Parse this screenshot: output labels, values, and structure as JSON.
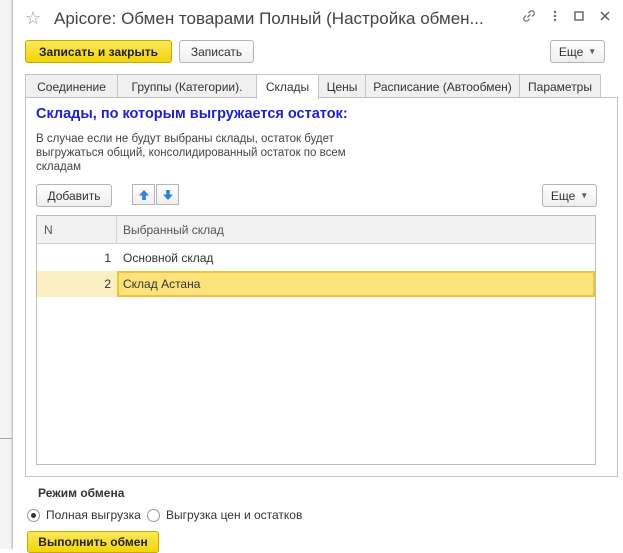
{
  "window": {
    "title": "Apicore: Обмен товарами Полный (Настройка обмен...",
    "icons": [
      "star-icon",
      "link-icon",
      "more-vertical-icon",
      "maximize-icon",
      "close-icon"
    ]
  },
  "toolbar": {
    "save_close_label": "Записать и закрыть",
    "save_label": "Записать",
    "more_label": "Еще"
  },
  "tabs": [
    {
      "label": "Соединение"
    },
    {
      "label": "Группы (Категории)."
    },
    {
      "label": "Склады",
      "active": true
    },
    {
      "label": "Цены"
    },
    {
      "label": "Расписание (Автообмен)"
    },
    {
      "label": "Параметры"
    }
  ],
  "warehouses": {
    "title": "Склады, по которым выгружается остаток:",
    "hint": "В случае если не будут выбраны склады, остаток будет выгружаться общий, консолидированный остаток по всем складам",
    "add_label": "Добавить",
    "more_label": "Еще",
    "columns": [
      "N",
      "Выбранный склад"
    ],
    "rows": [
      {
        "n": "1",
        "name": "Основной склад"
      },
      {
        "n": "2",
        "name": "Склад Астана",
        "selected": true
      }
    ]
  },
  "exchange_mode": {
    "title": "Режим обмена",
    "options": [
      {
        "label": "Полная выгрузка",
        "checked": true
      },
      {
        "label": "Выгрузка цен и остатков",
        "checked": false
      }
    ],
    "run_label": "Выполнить обмен"
  },
  "colors": {
    "accent_yellow": "#f2d40b",
    "section_title_blue": "#2020c8",
    "selection": "#fbe27a",
    "arrow_blue": "#2f7fd6"
  }
}
